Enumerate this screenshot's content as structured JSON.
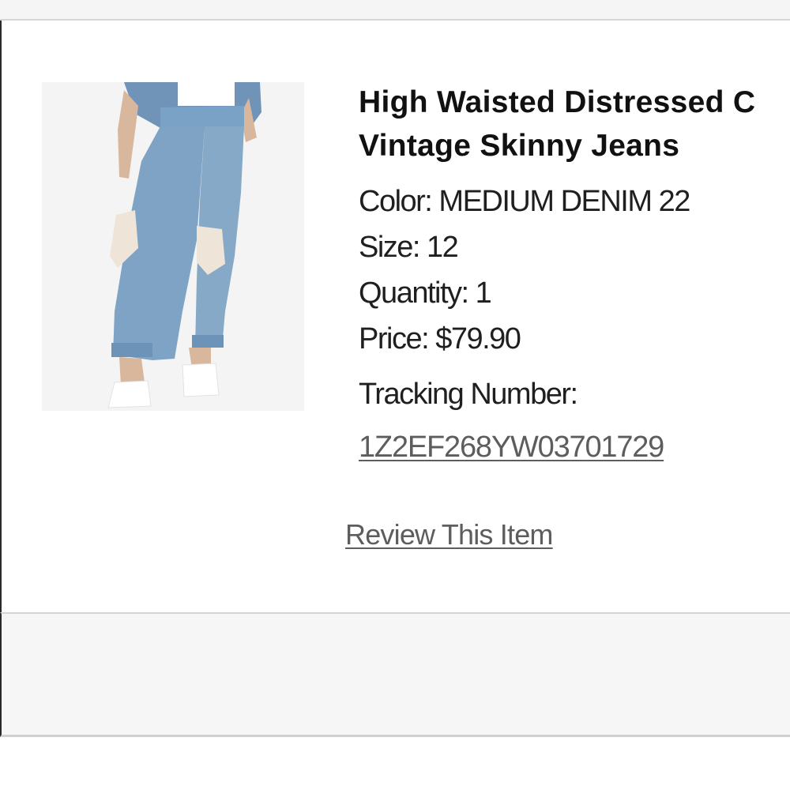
{
  "product": {
    "title_line1": "High Waisted Distressed C",
    "title_line2": "Vintage Skinny Jeans",
    "color": "Color: MEDIUM DENIM 22",
    "size": "Size: 12",
    "quantity": "Quantity: 1",
    "price": "Price: $79.90",
    "tracking_label": "Tracking Number:",
    "tracking_number": "1Z2EF268YW03701729",
    "review_link": "Review This Item",
    "image_icon": "product-photo-jeans"
  },
  "colors": {
    "text": "#1a1a1a",
    "link": "#5d5d5d",
    "panel_bg": "#f6f6f6",
    "denim": "#7fa3c4"
  }
}
